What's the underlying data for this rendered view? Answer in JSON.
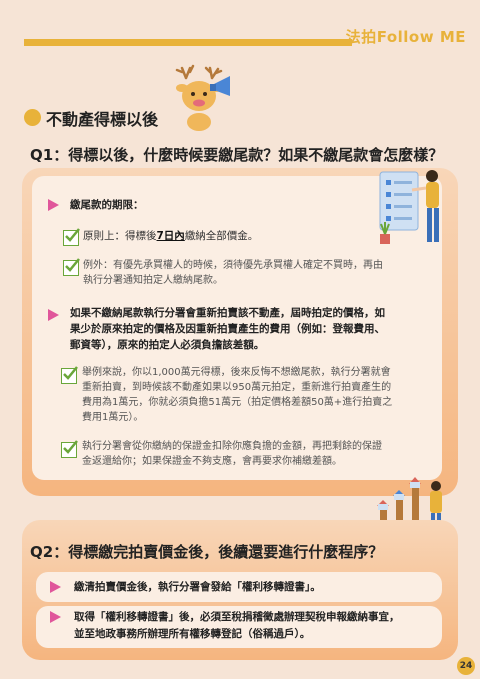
{
  "brand": "法拍Follow ME",
  "section_title": "不動產得標以後",
  "q1": {
    "title": "Q1：得標以後，什麼時候要繳尾款？如果不繳尾款會怎麼樣？",
    "deadline_heading": "繳尾款的期限：",
    "rule_prefix": "原則上：得標後",
    "rule_highlight": "7日內",
    "rule_suffix": "繳納全部價金。",
    "exception_line1": "例外：有優先承買權人的時候，須待優先承買權人確定不買時，再由",
    "exception_line2": "執行分署通知拍定人繳納尾款。",
    "consequence_line1": "如果不繳納尾款執行分署會重新拍賣該不動產，屆時拍定的價格，如",
    "consequence_line2": "果少於原來拍定的價格及因重新拍賣產生的費用（例如：登報費用、",
    "consequence_line3": "郵資等），原來的拍定人必須負擔該差額。",
    "example_line1": "舉例來說，你以1,000萬元得標，後來反悔不想繳尾款，執行分署就會",
    "example_line2": "重新拍賣，到時候該不動產如果以950萬元拍定，重新進行拍賣產生的",
    "example_line3": "費用為1萬元，你就必須負擔51萬元（拍定價格差額50萬+進行拍賣之",
    "example_line4": "費用1萬元）。",
    "deposit_line1": "執行分署會從你繳納的保證金扣除你應負擔的金額，再把剩餘的保證",
    "deposit_line2": "金返還給你；如果保證金不夠支應，會再要求你補繳差額。"
  },
  "q2": {
    "title": "Q2：得標繳完拍賣價金後，後續還要進行什麼程序？",
    "item1": "繳清拍賣價金後，執行分署會發給「權利移轉證書」。",
    "item2_line1": "取得「權利移轉證書」後，必須至稅捐稽徵處辦理契稅申報繳納事宜，",
    "item2_line2": "並至地政事務所辦理所有權移轉登記（俗稱過戶）。"
  },
  "page_number": "24",
  "colors": {
    "background": "#f6e4d6",
    "accent_yellow": "#e8b23a",
    "arrow_pink": "#e0569b",
    "check_green": "#6aa63a",
    "card_orange": "#f5b57f"
  },
  "icons": [
    "mascot-deer-megaphone",
    "checklist-woman-illustration",
    "house-chart-man-illustration",
    "check-icon",
    "arrow-icon"
  ]
}
